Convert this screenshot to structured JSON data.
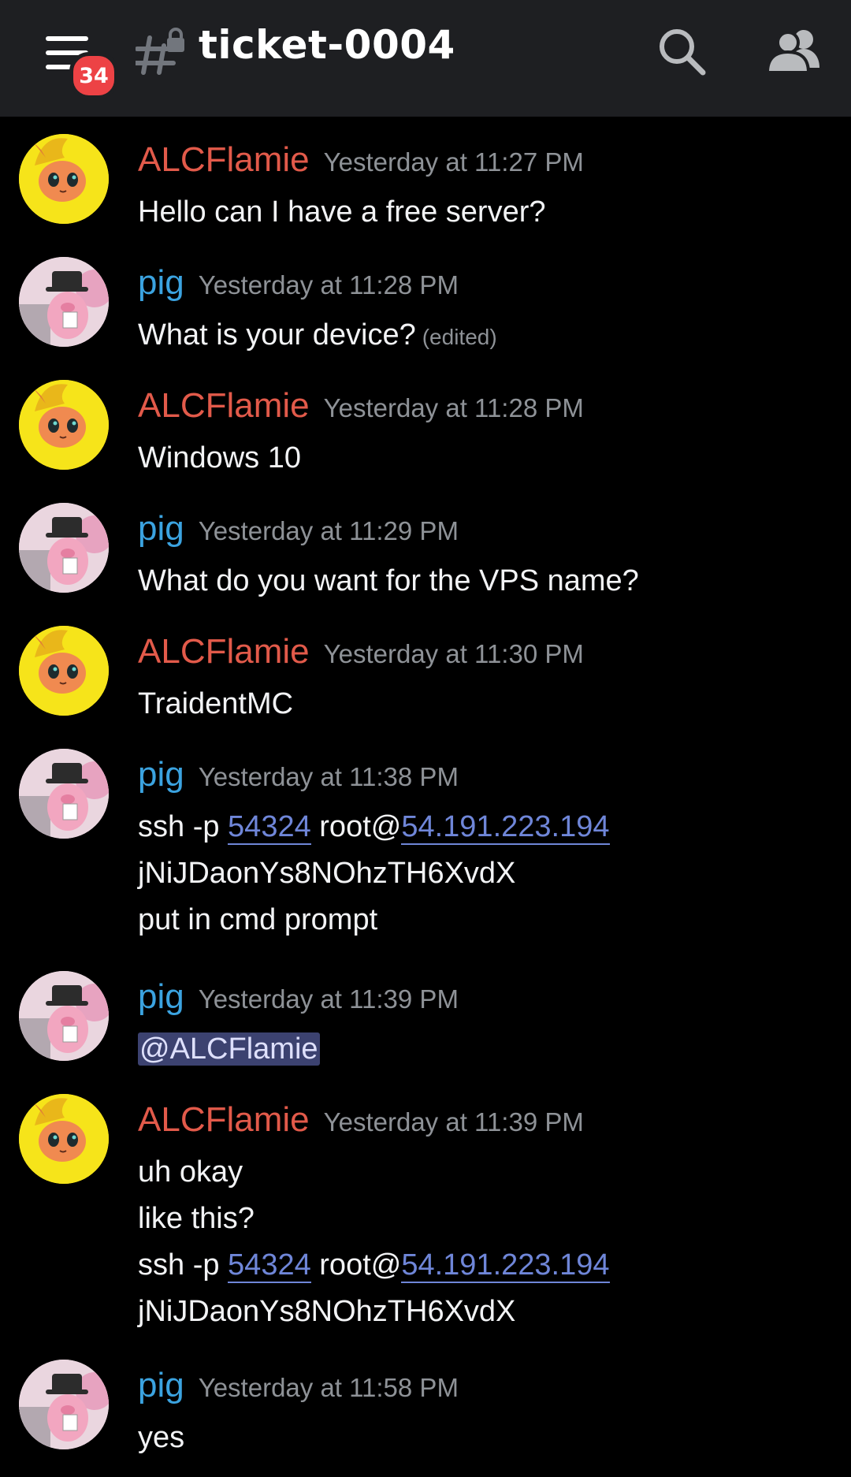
{
  "header": {
    "channel_name": "ticket-0004",
    "unread_badge": "34",
    "icons": [
      "hamburger-menu-icon",
      "locked-hashtag-icon",
      "search-icon",
      "members-icon"
    ]
  },
  "messages": [
    {
      "author": "ALCFlamie",
      "author_color": "#e25a4a",
      "time": "Yesterday at 11:27 PM",
      "lines": [
        "Hello can I have a free server?"
      ]
    },
    {
      "author": "pig",
      "author_color": "#3ba3e0",
      "time": "Yesterday at 11:28 PM",
      "lines": [
        "What is your device?"
      ],
      "edited": "(edited)"
    },
    {
      "author": "ALCFlamie",
      "author_color": "#e25a4a",
      "time": "Yesterday at 11:28 PM",
      "lines": [
        "Windows 10"
      ]
    },
    {
      "author": "pig",
      "author_color": "#3ba3e0",
      "time": "Yesterday at 11:29 PM",
      "lines": [
        "What do you want for the VPS name?"
      ]
    },
    {
      "author": "ALCFlamie",
      "author_color": "#e25a4a",
      "time": "Yesterday at 11:30 PM",
      "lines": [
        "TraidentMC"
      ]
    },
    {
      "author": "pig",
      "author_color": "#3ba3e0",
      "time": "Yesterday at 11:38 PM",
      "ssh": {
        "prefix": "ssh -p ",
        "port": "54324",
        "mid": " root@",
        "ip": "54.191.223.194"
      },
      "lines": [
        "jNiJDaonYs8NOhzTH6XvdX",
        "put in cmd prompt"
      ]
    },
    {
      "author": "pig",
      "author_color": "#3ba3e0",
      "time": "Yesterday at 11:39 PM",
      "mention": "@ALCFlamie"
    },
    {
      "author": "ALCFlamie",
      "author_color": "#e25a4a",
      "time": "Yesterday at 11:39 PM",
      "lines": [
        "uh okay",
        "like this?"
      ],
      "ssh": {
        "prefix": "ssh -p ",
        "port": "54324",
        "mid": " root@",
        "ip": "54.191.223.194"
      },
      "after": [
        "jNiJDaonYs8NOhzTH6XvdX"
      ]
    },
    {
      "author": "pig",
      "author_color": "#3ba3e0",
      "time": "Yesterday at 11:58 PM",
      "lines": [
        "yes"
      ]
    }
  ]
}
